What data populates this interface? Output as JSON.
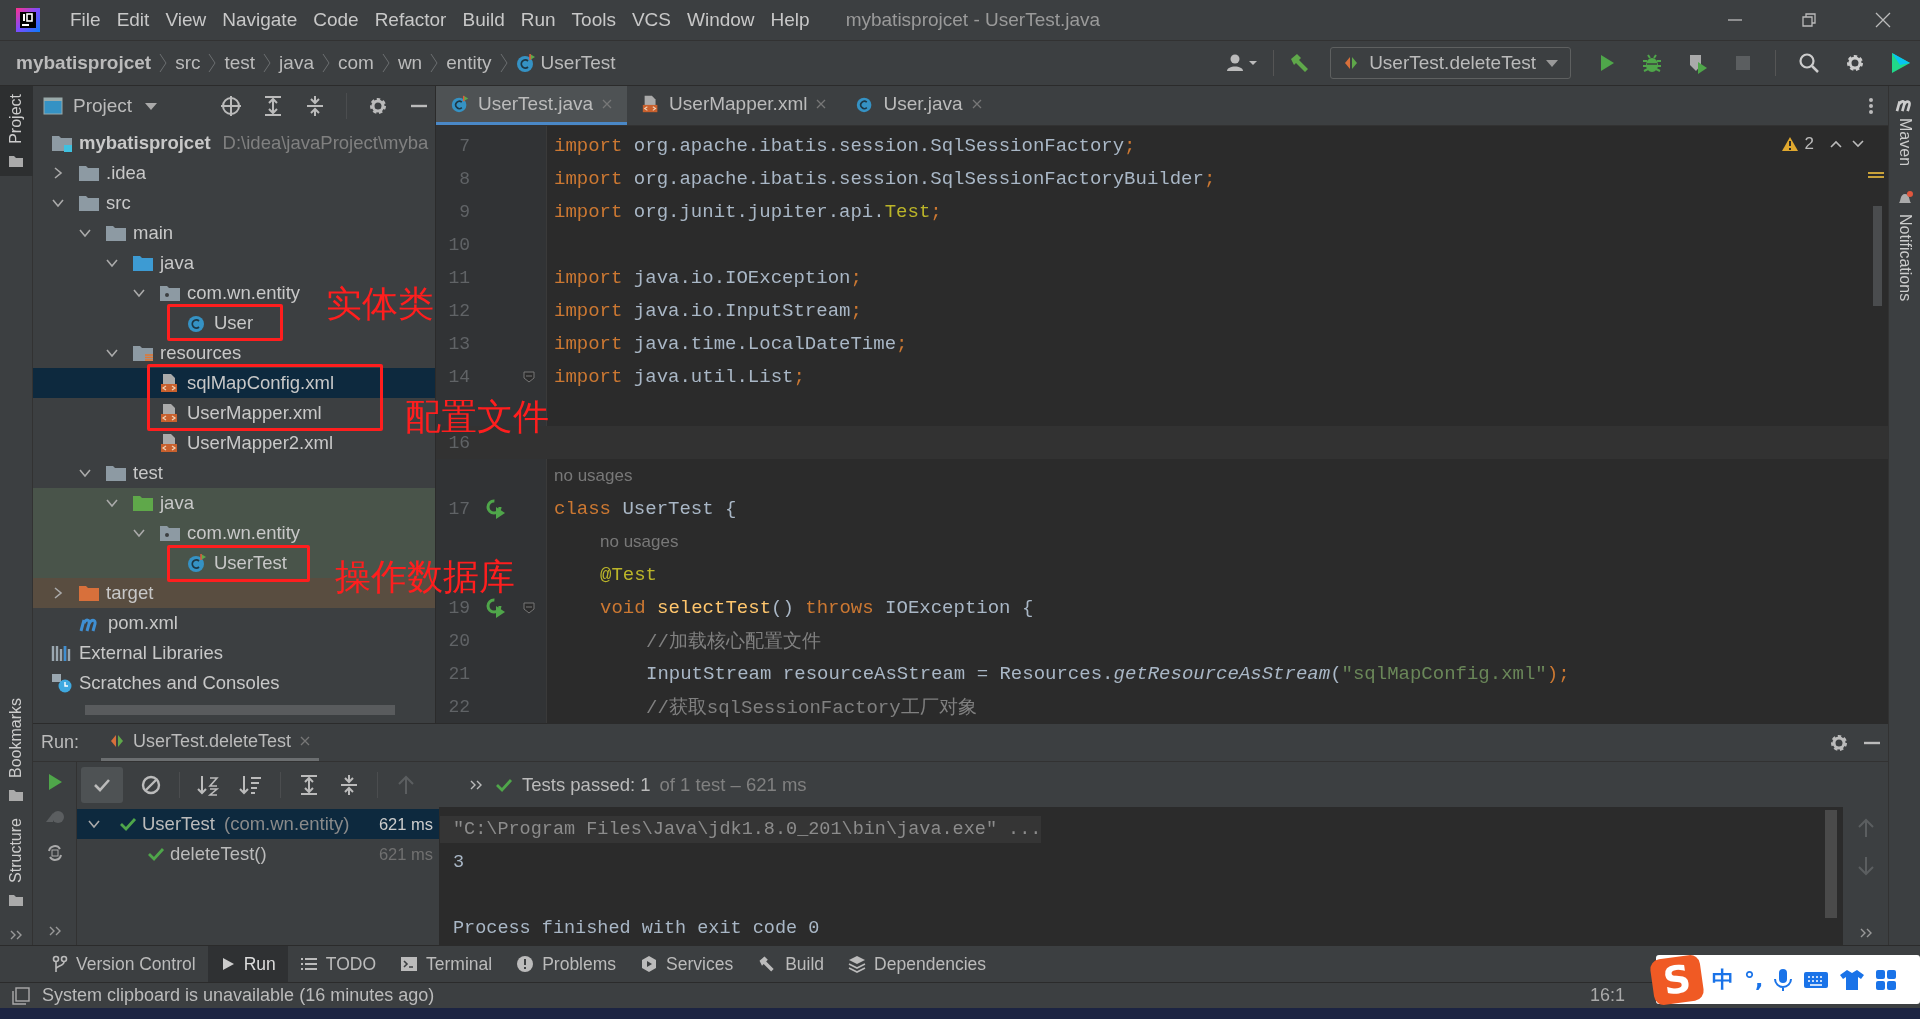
{
  "menu": [
    "File",
    "Edit",
    "View",
    "Navigate",
    "Code",
    "Refactor",
    "Build",
    "Run",
    "Tools",
    "VCS",
    "Window",
    "Help"
  ],
  "window_title": "mybatisprojcet - UserTest.java",
  "breadcrumbs": [
    {
      "label": "mybatisprojcet",
      "kind": "project"
    },
    {
      "label": "src",
      "kind": "dir"
    },
    {
      "label": "test",
      "kind": "dir"
    },
    {
      "label": "java",
      "kind": "dir"
    },
    {
      "label": "com",
      "kind": "dir"
    },
    {
      "label": "wn",
      "kind": "dir"
    },
    {
      "label": "entity",
      "kind": "dir"
    },
    {
      "label": "UserTest",
      "kind": "test-class"
    }
  ],
  "run_config": "UserTest.deleteTest",
  "left_tools": [
    {
      "label": "Project",
      "selected": true,
      "kind": "top"
    },
    {
      "label": "Bookmarks",
      "selected": false,
      "kind": "bottom"
    },
    {
      "label": "Structure",
      "selected": false,
      "kind": "bottom"
    }
  ],
  "right_tools": [
    {
      "label": "Maven",
      "kind": "maven"
    },
    {
      "label": "Notifications",
      "kind": "bell"
    }
  ],
  "project": {
    "title": "Project",
    "tree": [
      {
        "name": "mybatisprojcet",
        "path": "D:\\idea\\javaProject\\myba",
        "kind": "module",
        "selected": false,
        "children": [
          {
            "name": ".idea",
            "kind": "folder",
            "expanded": false,
            "selected": false
          },
          {
            "name": "src",
            "kind": "folder",
            "expanded": true,
            "selected": false,
            "children": [
              {
                "name": "main",
                "kind": "folder",
                "expanded": true,
                "selected": false,
                "children": [
                  {
                    "name": "java",
                    "kind": "source-folder",
                    "expanded": true,
                    "selected": false,
                    "children": [
                      {
                        "name": "com.wn.entity",
                        "kind": "package",
                        "expanded": true,
                        "selected": false,
                        "children": [
                          {
                            "name": "User",
                            "kind": "class",
                            "selected": false
                          }
                        ]
                      }
                    ]
                  },
                  {
                    "name": "resources",
                    "kind": "resources-folder",
                    "expanded": true,
                    "selected": false,
                    "children": [
                      {
                        "name": "sqlMapConfig.xml",
                        "kind": "xml",
                        "selected": true
                      },
                      {
                        "name": "UserMapper.xml",
                        "kind": "xml",
                        "selected": false
                      },
                      {
                        "name": "UserMapper2.xml",
                        "kind": "xml",
                        "selected": false
                      }
                    ]
                  }
                ]
              },
              {
                "name": "test",
                "kind": "folder",
                "expanded": true,
                "selected": false,
                "children": [
                  {
                    "name": "java",
                    "kind": "test-folder",
                    "expanded": true,
                    "selected": false,
                    "test_source": true,
                    "children": [
                      {
                        "name": "com.wn.entity",
                        "kind": "package",
                        "expanded": true,
                        "selected": false,
                        "test_source": true,
                        "children": [
                          {
                            "name": "UserTest",
                            "kind": "test-class",
                            "selected": false,
                            "test_source": true
                          }
                        ]
                      }
                    ]
                  }
                ]
              }
            ]
          },
          {
            "name": "target",
            "kind": "excluded-folder",
            "expanded": false,
            "selected": false,
            "excluded": true
          },
          {
            "name": "pom.xml",
            "kind": "maven",
            "selected": false
          }
        ]
      },
      {
        "name": "External Libraries",
        "kind": "libraries",
        "selected": false
      },
      {
        "name": "Scratches and Consoles",
        "kind": "scratches",
        "selected": false
      }
    ]
  },
  "tabs": [
    {
      "label": "UserTest.java",
      "kind": "test-class",
      "selected": true
    },
    {
      "label": "UserMapper.xml",
      "kind": "xml",
      "selected": false
    },
    {
      "label": "User.java",
      "kind": "class",
      "selected": false
    }
  ],
  "warnings": "2",
  "code": [
    {
      "kind": "top",
      "num": "7",
      "tokens": [
        {
          "t": "import ",
          "kind": "keyword"
        },
        {
          "t": "org.apache.ibatis.session.SqlSessionFactory",
          "kind": "plain"
        },
        {
          "t": ";",
          "kind": "keyword"
        }
      ]
    },
    {
      "kind": "top",
      "num": "8",
      "tokens": [
        {
          "t": "import ",
          "kind": "keyword"
        },
        {
          "t": "org.apache.ibatis.session.SqlSessionFactoryBuilder",
          "kind": "plain"
        },
        {
          "t": ";",
          "kind": "keyword"
        }
      ]
    },
    {
      "kind": "top",
      "num": "9",
      "tokens": [
        {
          "t": "import ",
          "kind": "keyword"
        },
        {
          "t": "org.junit.jupiter.api.",
          "kind": "plain"
        },
        {
          "t": "Test",
          "kind": "annotation"
        },
        {
          "t": ";",
          "kind": "keyword"
        }
      ]
    },
    {
      "kind": "top",
      "num": "10"
    },
    {
      "kind": "top",
      "num": "11",
      "tokens": [
        {
          "t": "import ",
          "kind": "keyword"
        },
        {
          "t": "java.io.IOException",
          "kind": "plain"
        },
        {
          "t": ";",
          "kind": "keyword"
        }
      ]
    },
    {
      "kind": "top",
      "num": "12",
      "tokens": [
        {
          "t": "import ",
          "kind": "keyword"
        },
        {
          "t": "java.io.InputStream",
          "kind": "plain"
        },
        {
          "t": ";",
          "kind": "keyword"
        }
      ]
    },
    {
      "kind": "top",
      "num": "13",
      "tokens": [
        {
          "t": "import ",
          "kind": "keyword"
        },
        {
          "t": "java.time.LocalDateTime",
          "kind": "plain"
        },
        {
          "t": ";",
          "kind": "keyword"
        }
      ]
    },
    {
      "kind": "top",
      "num": "14",
      "fold_marker": true,
      "tokens": [
        {
          "t": "import ",
          "kind": "keyword"
        },
        {
          "t": "java.util.List",
          "kind": "plain"
        },
        {
          "t": ";",
          "kind": "keyword"
        }
      ]
    },
    {
      "kind": "top"
    },
    {
      "kind": "top",
      "num": "16",
      "current": true
    },
    {
      "kind": "hint",
      "tokens": [
        {
          "t": "no usages",
          "kind": "hint"
        }
      ]
    },
    {
      "kind": "top",
      "num": "17",
      "run_marker": true,
      "tokens": [
        {
          "t": "class ",
          "kind": "keyword"
        },
        {
          "t": "UserTest {",
          "kind": "plain"
        }
      ]
    },
    {
      "kind": "member-hint",
      "tokens": [
        {
          "t": "no usages",
          "kind": "hint"
        }
      ]
    },
    {
      "kind": "member",
      "tokens": [
        {
          "t": "@Test",
          "kind": "annotation"
        }
      ]
    },
    {
      "kind": "member",
      "num": "19",
      "run_marker": true,
      "fold_marker": true,
      "tokens": [
        {
          "t": "void ",
          "kind": "keyword"
        },
        {
          "t": "selectTest",
          "kind": "method"
        },
        {
          "t": "() ",
          "kind": "plain"
        },
        {
          "t": "throws ",
          "kind": "keyword"
        },
        {
          "t": "IOException {",
          "kind": "plain"
        }
      ]
    },
    {
      "kind": "statement",
      "num": "20",
      "tokens": [
        {
          "t": "//加载核心配置文件",
          "kind": "comment"
        }
      ]
    },
    {
      "kind": "statement",
      "num": "21",
      "tokens": [
        {
          "t": "InputStream resourceAsStream = Resources.",
          "kind": "plain"
        },
        {
          "t": "getResourceAsStream",
          "kind": "static-call"
        },
        {
          "t": "(",
          "kind": "plain"
        },
        {
          "t": "\"sqlMapConfig.xml\"",
          "kind": "string"
        },
        {
          "t": ");",
          "kind": "keyword"
        }
      ]
    },
    {
      "kind": "statement",
      "num": "22",
      "tokens": [
        {
          "t": "//获取sqlSessionFactory工厂对象",
          "kind": "comment"
        }
      ]
    }
  ],
  "run": {
    "label": "Run:",
    "tab": "UserTest.deleteTest",
    "passed": "Tests passed: 1",
    "summary": "of 1 test – 621 ms",
    "tests": [
      {
        "name": "UserTest",
        "package": "(com.wn.entity)",
        "time": "621 ms",
        "kind": "passed",
        "selected": true,
        "expanded": true,
        "children": [
          {
            "name": "deleteTest()",
            "time": "621 ms",
            "kind": "passed",
            "selected": false
          }
        ]
      }
    ],
    "console": [
      {
        "kind": "cmd",
        "text": "\"C:\\Program Files\\Java\\jdk1.8.0_201\\bin\\java.exe\" ..."
      },
      {
        "kind": "out",
        "text": "3"
      },
      {
        "kind": "blank"
      },
      {
        "kind": "out",
        "text": "Process finished with exit code 0"
      }
    ]
  },
  "tool_tabs": [
    {
      "label": "Version Control",
      "kind": "vcs",
      "selected": false
    },
    {
      "label": "Run",
      "kind": "run",
      "selected": true
    },
    {
      "label": "TODO",
      "kind": "todo",
      "selected": false
    },
    {
      "label": "Terminal",
      "kind": "terminal",
      "selected": false
    },
    {
      "label": "Problems",
      "kind": "problems",
      "selected": false
    },
    {
      "label": "Services",
      "kind": "services",
      "selected": false
    },
    {
      "label": "Build",
      "kind": "build",
      "selected": false
    },
    {
      "label": "Dependencies",
      "kind": "dependencies",
      "selected": false
    }
  ],
  "status": {
    "message": "System clipboard is unavailable (16 minutes ago)",
    "position": "16:1"
  },
  "ime": {
    "logo": "S",
    "mode": "中",
    "punctuation": "°,"
  },
  "annotations": [
    {
      "text": "实体类"
    },
    {
      "text": "配置文件"
    },
    {
      "text": "操作数据库"
    }
  ]
}
